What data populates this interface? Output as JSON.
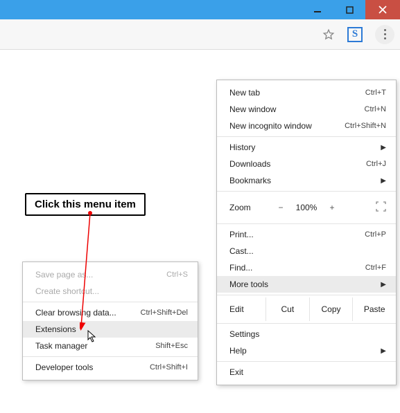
{
  "callout": {
    "text": "Click this menu item"
  },
  "main_menu": {
    "new_tab": {
      "label": "New tab",
      "shortcut": "Ctrl+T"
    },
    "new_window": {
      "label": "New window",
      "shortcut": "Ctrl+N"
    },
    "new_incognito": {
      "label": "New incognito window",
      "shortcut": "Ctrl+Shift+N"
    },
    "history": {
      "label": "History"
    },
    "downloads": {
      "label": "Downloads",
      "shortcut": "Ctrl+J"
    },
    "bookmarks": {
      "label": "Bookmarks"
    },
    "zoom": {
      "label": "Zoom",
      "minus": "−",
      "pct": "100%",
      "plus": "+"
    },
    "print": {
      "label": "Print...",
      "shortcut": "Ctrl+P"
    },
    "cast": {
      "label": "Cast..."
    },
    "find": {
      "label": "Find...",
      "shortcut": "Ctrl+F"
    },
    "more_tools": {
      "label": "More tools"
    },
    "edit": {
      "label": "Edit",
      "cut": "Cut",
      "copy": "Copy",
      "paste": "Paste"
    },
    "settings": {
      "label": "Settings"
    },
    "help": {
      "label": "Help"
    },
    "exit": {
      "label": "Exit"
    }
  },
  "sub_menu": {
    "save_page": {
      "label": "Save page as...",
      "shortcut": "Ctrl+S"
    },
    "create_shortcut": {
      "label": "Create shortcut..."
    },
    "clear_data": {
      "label": "Clear browsing data...",
      "shortcut": "Ctrl+Shift+Del"
    },
    "extensions": {
      "label": "Extensions"
    },
    "task_manager": {
      "label": "Task manager",
      "shortcut": "Shift+Esc"
    },
    "dev_tools": {
      "label": "Developer tools",
      "shortcut": "Ctrl+Shift+I"
    }
  },
  "ext_badge": {
    "letter": "S"
  }
}
